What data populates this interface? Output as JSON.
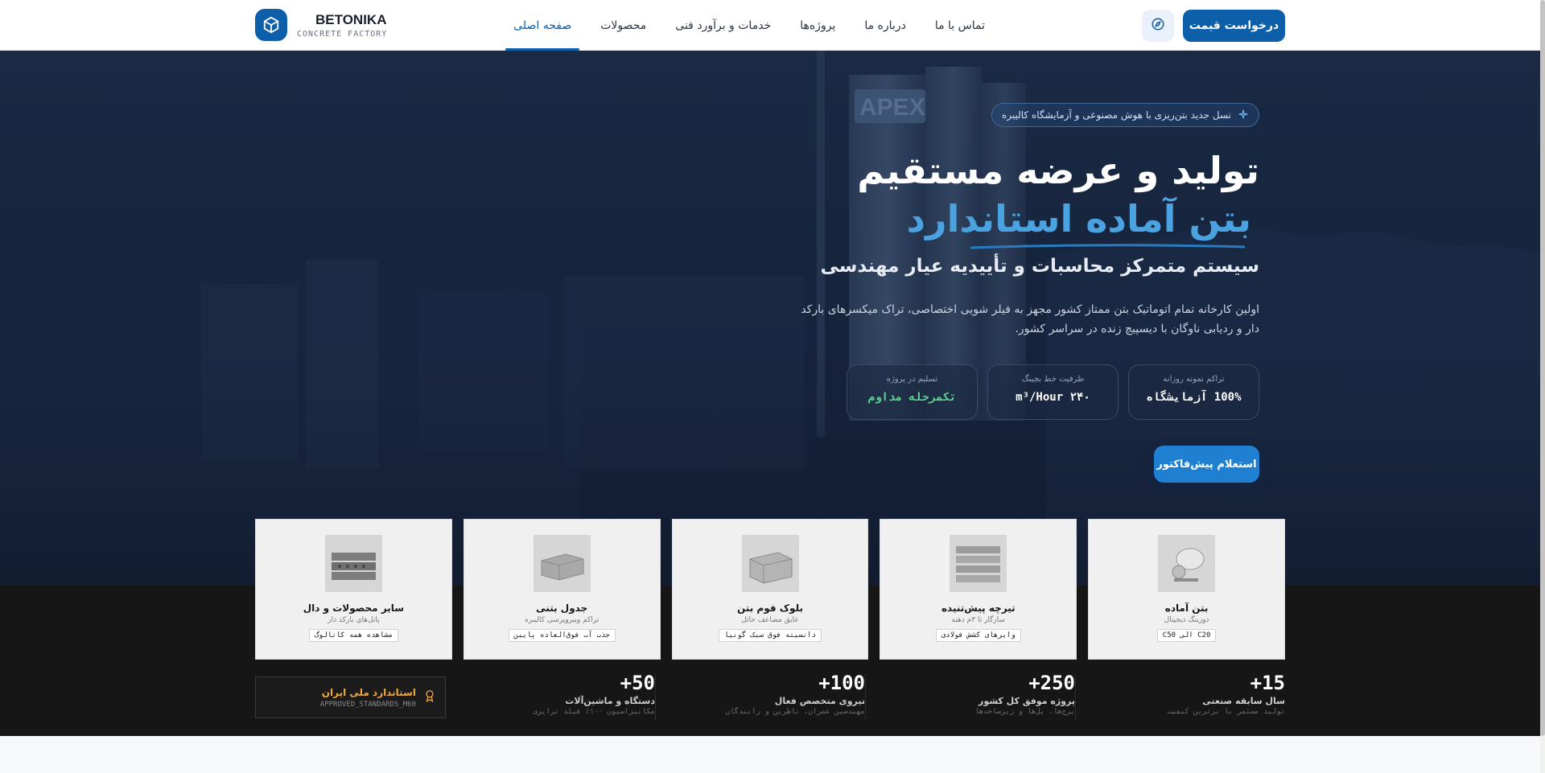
{
  "brand": {
    "name": "BETONIKA",
    "subtitle": "CONCRETE FACTORY"
  },
  "nav": {
    "items": [
      {
        "label": "صفحه اصلی",
        "active": true
      },
      {
        "label": "محصولات",
        "active": false
      },
      {
        "label": "خدمات و برآورد فنی",
        "active": false
      },
      {
        "label": "پروژه‌ها",
        "active": false
      },
      {
        "label": "درباره ما",
        "active": false
      },
      {
        "label": "تماس با ما",
        "active": false
      }
    ],
    "cta_label": "درخواست قیمت"
  },
  "hero": {
    "badge": "نسل جدید بتن‌ریزی با هوش مصنوعی و آزمایشگاه کالیبره",
    "title_line1": "تولید و عرضه مستقیم",
    "title_line2": "بتن آماده استاندارد",
    "subtitle": "سیستم متمرکز محاسبات و تأییدیه عیار مهندسی",
    "description": "اولین کارخانه تمام اتوماتیک بتن ممتاز کشور مجهز به فیلر شویی اختصاصی، تراک میکسرهای بارکد دار و ردیابی ناوگان با دیسپیچ زنده در سراسر کشور.",
    "stats": [
      {
        "label": "تراکم نمونه روزانه",
        "value": "100% آزمایشگاه"
      },
      {
        "label": "ظرفیت خط بچینگ",
        "value": "m³/Hour ۲۴۰"
      },
      {
        "label": "تسلیم در پروژه",
        "value": "تکمرحله مداوم"
      }
    ],
    "button_label": "استعلام پیش‌فاکتور"
  },
  "products": [
    {
      "title": "بتن آماده",
      "subtitle": "دوزینگ دیجیتال",
      "tag": "C20 الی C50"
    },
    {
      "title": "تیرچه پیش‌تنیده",
      "subtitle": "سازگار تا ۳م دهنه",
      "tag": "وایرهای کشش فولادی"
    },
    {
      "title": "بلوک فوم بتن",
      "subtitle": "عایق مضاعف حائل",
      "tag": "دانسیته فوق سبک گونیا"
    },
    {
      "title": "جدول بتنی",
      "subtitle": "تراکم ویبروپرسی کالیبره",
      "tag": "جذب آب فوق‌العاده پایین"
    },
    {
      "title": "سایر محصولات و دال",
      "subtitle": "پانل‌های بارکد دار",
      "tag": "مشاهده همه کاتالوگ"
    }
  ],
  "metrics": [
    {
      "number": "+15",
      "label": "سال سابقه صنعتی",
      "sub": "تولید مستمر با برترین کیفیت"
    },
    {
      "number": "+250",
      "label": "پروژه موفق کل کشور",
      "sub": "برج‌ها، پل‌ها و زیرساخت‌ها"
    },
    {
      "number": "+100",
      "label": "نیروی متخصص فعال",
      "sub": "مهندسین عمران، ناظرین و رانندگان"
    },
    {
      "number": "+50",
      "label": "دستگاه و ماشین‌آلات",
      "sub": "مکانیزاسیون ۱۰۰٪ فیلد تراپری"
    }
  ],
  "standard": {
    "title": "استاندارد ملی ایران",
    "code": "APPROVED_STANDARDS_M60"
  },
  "colors": {
    "primary": "#0d5fa9",
    "accent": "#4aa3e0",
    "success": "#5fd38f",
    "warning": "#f2a93b"
  }
}
